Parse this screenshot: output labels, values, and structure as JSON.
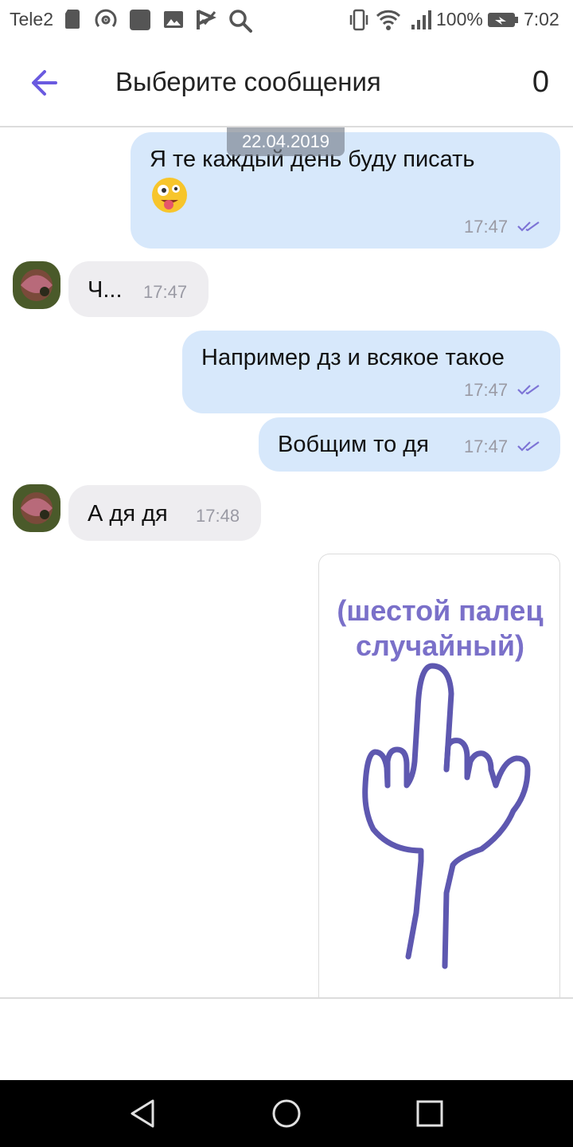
{
  "status_bar": {
    "carrier": "Tele2",
    "battery": "100%",
    "time": "7:02",
    "left_icons": [
      "sd-card-icon",
      "hotspot-icon",
      "app-square-icon",
      "gallery-icon",
      "check-flag-icon",
      "search-icon"
    ],
    "right_icons": [
      "vibrate-icon",
      "wifi-icon",
      "signal-icon",
      "battery-charging-icon"
    ]
  },
  "header": {
    "title": "Выберите сообщения",
    "selected_count": "0",
    "accent_color": "#6a5ae0"
  },
  "chat": {
    "date_badge": "22.04.2019",
    "messages": [
      {
        "direction": "outgoing",
        "text_line1": "Я те каждый день буду писать",
        "emoji": "crazy-face-emoji",
        "time": "17:47",
        "status": "read"
      },
      {
        "direction": "incoming",
        "text": "Ч...",
        "time": "17:47"
      },
      {
        "direction": "outgoing",
        "text": "Например дз и всякое такое",
        "time": "17:47",
        "status": "read"
      },
      {
        "direction": "outgoing",
        "text": "Вобщим то дя",
        "time": "17:47",
        "status": "read"
      },
      {
        "direction": "incoming",
        "text": "А дя дя",
        "time": "17:48"
      }
    ],
    "image_message": {
      "caption_line1": "(шестой палец",
      "caption_line2": "случайный)",
      "drawing": "six-finger-hand-drawing"
    }
  },
  "colors": {
    "outgoing_bubble": "#d7e8fb",
    "incoming_bubble": "#eeedf0",
    "read_ticks": "#7d74d6",
    "caption": "#7a70c9"
  },
  "nav": {
    "buttons": [
      "back-icon",
      "home-icon",
      "recents-icon"
    ]
  }
}
